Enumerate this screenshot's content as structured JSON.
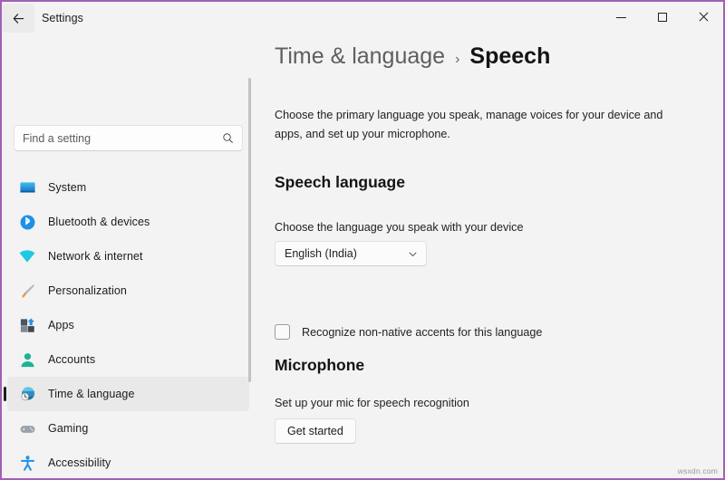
{
  "window": {
    "app_title": "Settings",
    "back_icon": "back-arrow-icon",
    "border_color": "#a35fb4",
    "controls": {
      "minimize": "minimize-icon",
      "maximize": "maximize-icon",
      "close": "close-icon"
    }
  },
  "sidebar": {
    "search": {
      "placeholder": "Find a setting",
      "value": "",
      "icon": "search-icon"
    },
    "items": [
      {
        "label": "System",
        "icon": "monitor-icon",
        "selected": false
      },
      {
        "label": "Bluetooth & devices",
        "icon": "bluetooth-icon",
        "selected": false
      },
      {
        "label": "Network & internet",
        "icon": "wifi-icon",
        "selected": false
      },
      {
        "label": "Personalization",
        "icon": "paintbrush-icon",
        "selected": false
      },
      {
        "label": "Apps",
        "icon": "apps-grid-icon",
        "selected": false
      },
      {
        "label": "Accounts",
        "icon": "person-icon",
        "selected": false
      },
      {
        "label": "Time & language",
        "icon": "globe-clock-icon",
        "selected": true
      },
      {
        "label": "Gaming",
        "icon": "gamepad-icon",
        "selected": false
      },
      {
        "label": "Accessibility",
        "icon": "accessibility-icon",
        "selected": false
      }
    ]
  },
  "main": {
    "breadcrumb": {
      "parent": "Time & language",
      "separator": "›",
      "current": "Speech"
    },
    "description": "Choose the primary language you speak, manage voices for your device and apps, and set up your microphone.",
    "speech_language": {
      "heading": "Speech language",
      "field_label": "Choose the language you speak with your device",
      "dropdown_value": "English (India)",
      "dropdown_icon": "chevron-down-icon",
      "checkbox_label": "Recognize non-native accents for this language",
      "checkbox_checked": false
    },
    "microphone": {
      "heading": "Microphone",
      "field_label": "Set up your mic for speech recognition",
      "button_label": "Get started"
    }
  },
  "watermark": "wsxdn.com"
}
